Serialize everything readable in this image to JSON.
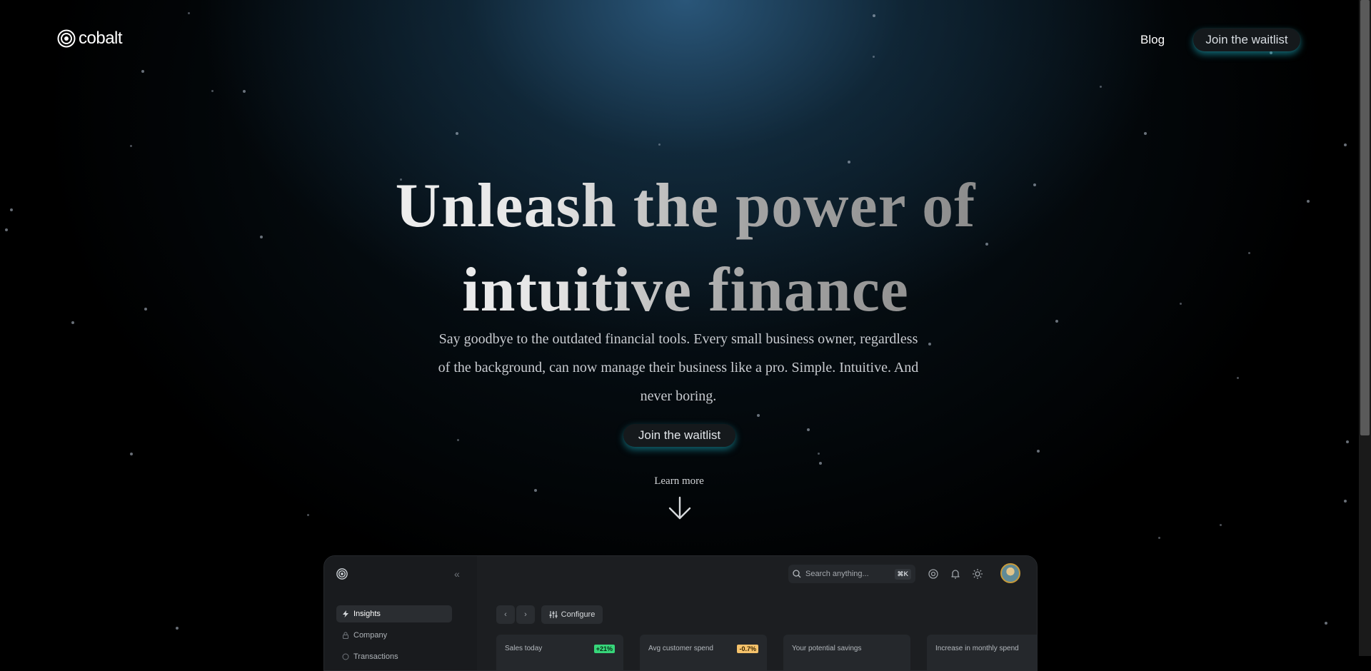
{
  "brand": {
    "name": "cobalt"
  },
  "nav": {
    "blog": "Blog",
    "cta": "Join the waitlist"
  },
  "hero": {
    "title_line1": "Unleash the power of",
    "title_line2": "intuitive finance",
    "subtitle": "Say goodbye to the outdated financial tools. Every small business owner, regardless of the background, can now manage their business like a pro. Simple. Intuitive. And never boring.",
    "cta": "Join the waitlist",
    "learn_more": "Learn more"
  },
  "dashboard": {
    "sidebar": [
      {
        "label": "Insights",
        "icon": "bolt-icon",
        "active": true
      },
      {
        "label": "Company",
        "icon": "lock-icon",
        "active": false
      },
      {
        "label": "Transactions",
        "icon": "circle-icon",
        "active": false
      }
    ],
    "search": {
      "placeholder": "Search anything...",
      "shortcut": "⌘K"
    },
    "toolbar": {
      "configure": "Configure"
    },
    "cards": [
      {
        "label": "Sales today",
        "badge": "+21%",
        "trend": "up"
      },
      {
        "label": "Avg customer spend",
        "badge": "-0.7%",
        "trend": "down"
      },
      {
        "label": "Your potential savings",
        "badge": "",
        "trend": ""
      },
      {
        "label": "Increase in monthly spend",
        "badge": "",
        "trend": ""
      }
    ]
  },
  "colors": {
    "accent_glow": "#1ec0d2",
    "button_bg": "#15191c",
    "page_bg": "#000000",
    "badge_up": "#37d67a",
    "badge_down": "#f5c26b"
  }
}
